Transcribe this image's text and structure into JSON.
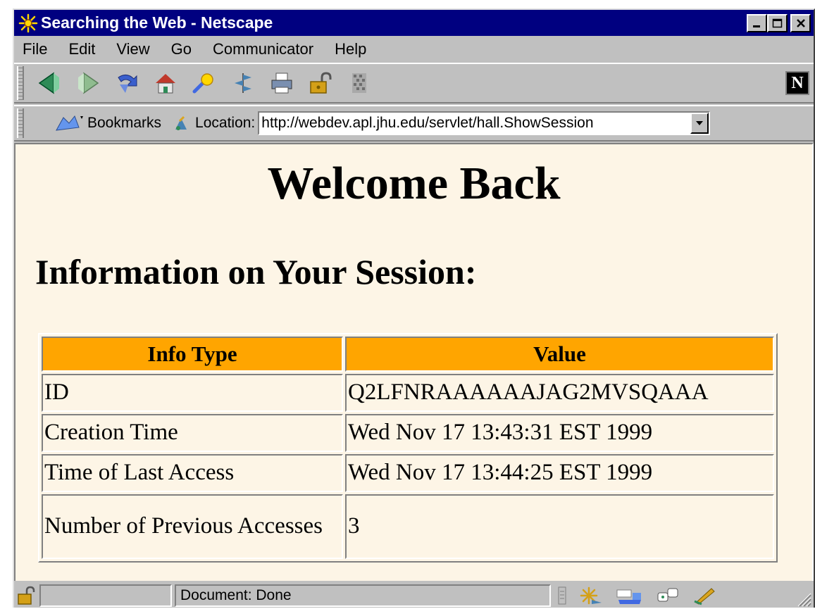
{
  "window": {
    "title": "Searching the Web - Netscape"
  },
  "menubar": {
    "items": [
      "File",
      "Edit",
      "View",
      "Go",
      "Communicator",
      "Help"
    ]
  },
  "toolbar": {
    "buttons": [
      "back-icon",
      "forward-icon",
      "reload-icon",
      "home-icon",
      "search-icon",
      "guide-icon",
      "print-icon",
      "security-icon",
      "stop-icon"
    ],
    "logo": "N"
  },
  "location_bar": {
    "bookmarks_label": "Bookmarks",
    "location_label": "Location:",
    "url": "http://webdev.apl.jhu.edu/servlet/hall.ShowSession"
  },
  "page": {
    "heading": "Welcome Back",
    "subheading": "Information on Your Session:",
    "table": {
      "headers": [
        "Info Type",
        "Value"
      ],
      "header_color": "#ffa500",
      "rows": [
        [
          "ID",
          "Q2LFNRAAAAAAJAG2MVSQAAA"
        ],
        [
          "Creation Time",
          "Wed Nov 17 13:43:31 EST 1999"
        ],
        [
          "Time of Last Access",
          "Wed Nov 17 13:44:25 EST 1999"
        ],
        [
          "Number of Previous Accesses",
          "3"
        ]
      ]
    },
    "background": "#fdf5e6"
  },
  "statusbar": {
    "status_text": "Document: Done"
  }
}
